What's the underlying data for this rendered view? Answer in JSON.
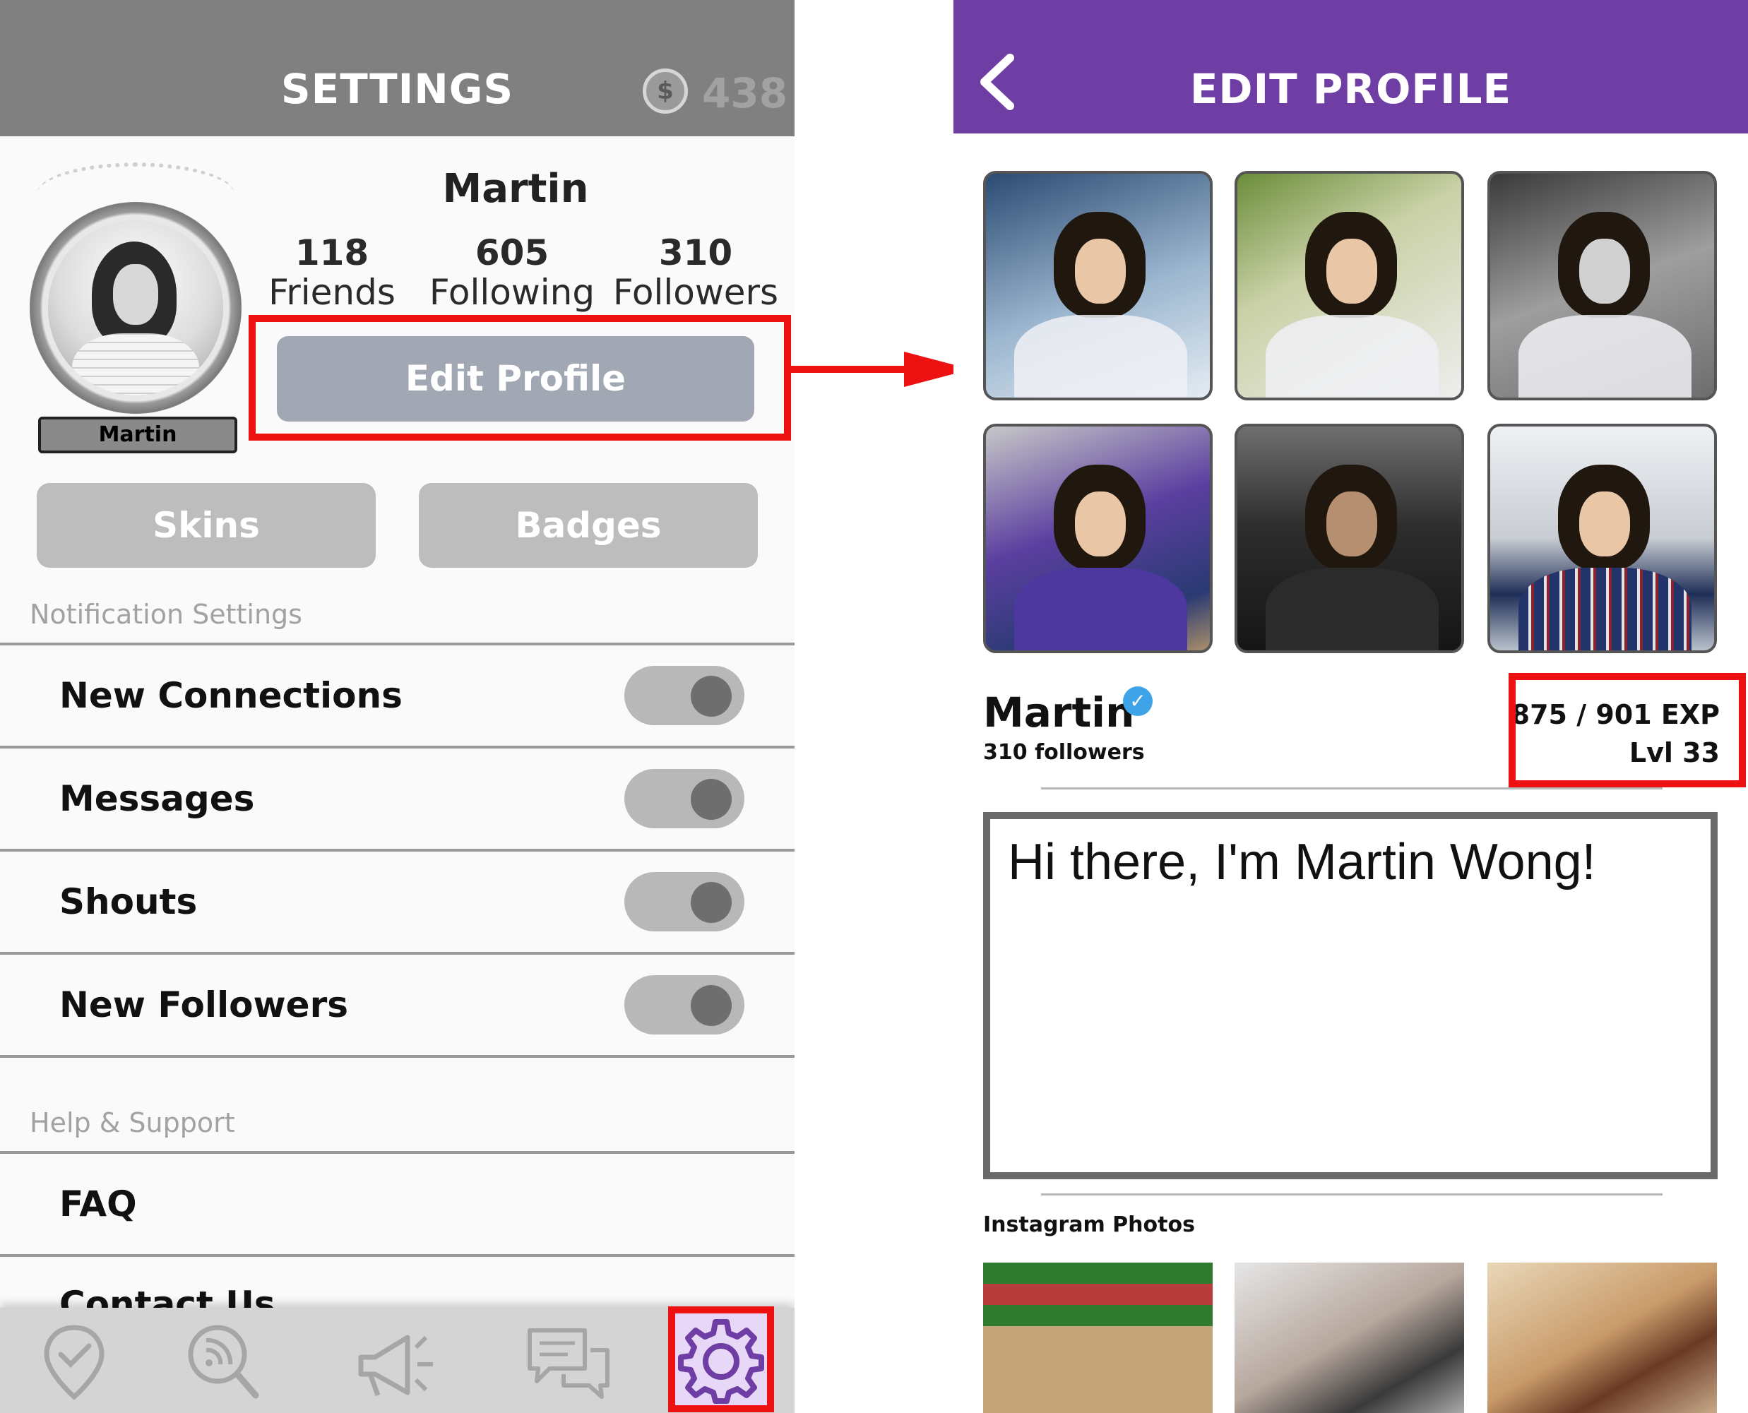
{
  "settings_screen": {
    "title": "SETTINGS",
    "coins_icon_glyph": "$",
    "coins": "438",
    "avatar_name_tag": "Martin",
    "profile_name": "Martin",
    "stats": [
      {
        "count": "118",
        "label": "Friends"
      },
      {
        "count": "605",
        "label": "Following"
      },
      {
        "count": "310",
        "label": "Followers"
      }
    ],
    "edit_profile_label": "Edit Profile",
    "skins_label": "Skins",
    "badges_label": "Badges",
    "notification_section": "Notification Settings",
    "notifications": [
      {
        "label": "New Connections",
        "on": true
      },
      {
        "label": "Messages",
        "on": true
      },
      {
        "label": "Shouts",
        "on": true
      },
      {
        "label": "New Followers",
        "on": true
      }
    ],
    "help_section": "Help & Support",
    "faq_label": "FAQ",
    "contact_label": "Contact Us",
    "tabs": [
      {
        "icon": "map-pin-check-icon",
        "selected": false
      },
      {
        "icon": "search-signal-icon",
        "selected": false
      },
      {
        "icon": "megaphone-icon",
        "selected": false
      },
      {
        "icon": "chat-bubbles-icon",
        "selected": false
      },
      {
        "icon": "gear-icon",
        "selected": true
      }
    ]
  },
  "edit_profile_screen": {
    "title": "EDIT PROFILE",
    "name": "Martin",
    "verified_glyph": "✓",
    "followers": "310 followers",
    "exp": "875 / 901 EXP",
    "level": "Lvl 33",
    "bio": "Hi there, I'm Martin Wong!",
    "instagram_label": "Instagram Photos"
  },
  "colors": {
    "settings_header": "#808080",
    "edit_profile_header": "#6f3ea5",
    "highlight": "#ee1111",
    "edit_button": "#a1a8b3",
    "verified": "#3fa3e8"
  }
}
